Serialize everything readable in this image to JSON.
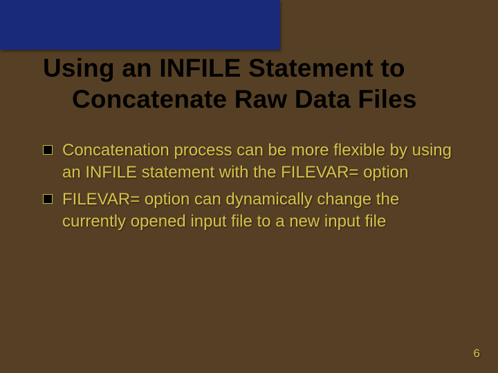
{
  "title": {
    "line1": "Using an INFILE Statement to",
    "line2": "Concatenate Raw Data Files"
  },
  "bullets": [
    "Concatenation process can be more flexible by using an INFILE statement with the FILEVAR= option",
    "FILEVAR= option can dynamically change the currently opened input file to a new input file"
  ],
  "page_number": "6"
}
